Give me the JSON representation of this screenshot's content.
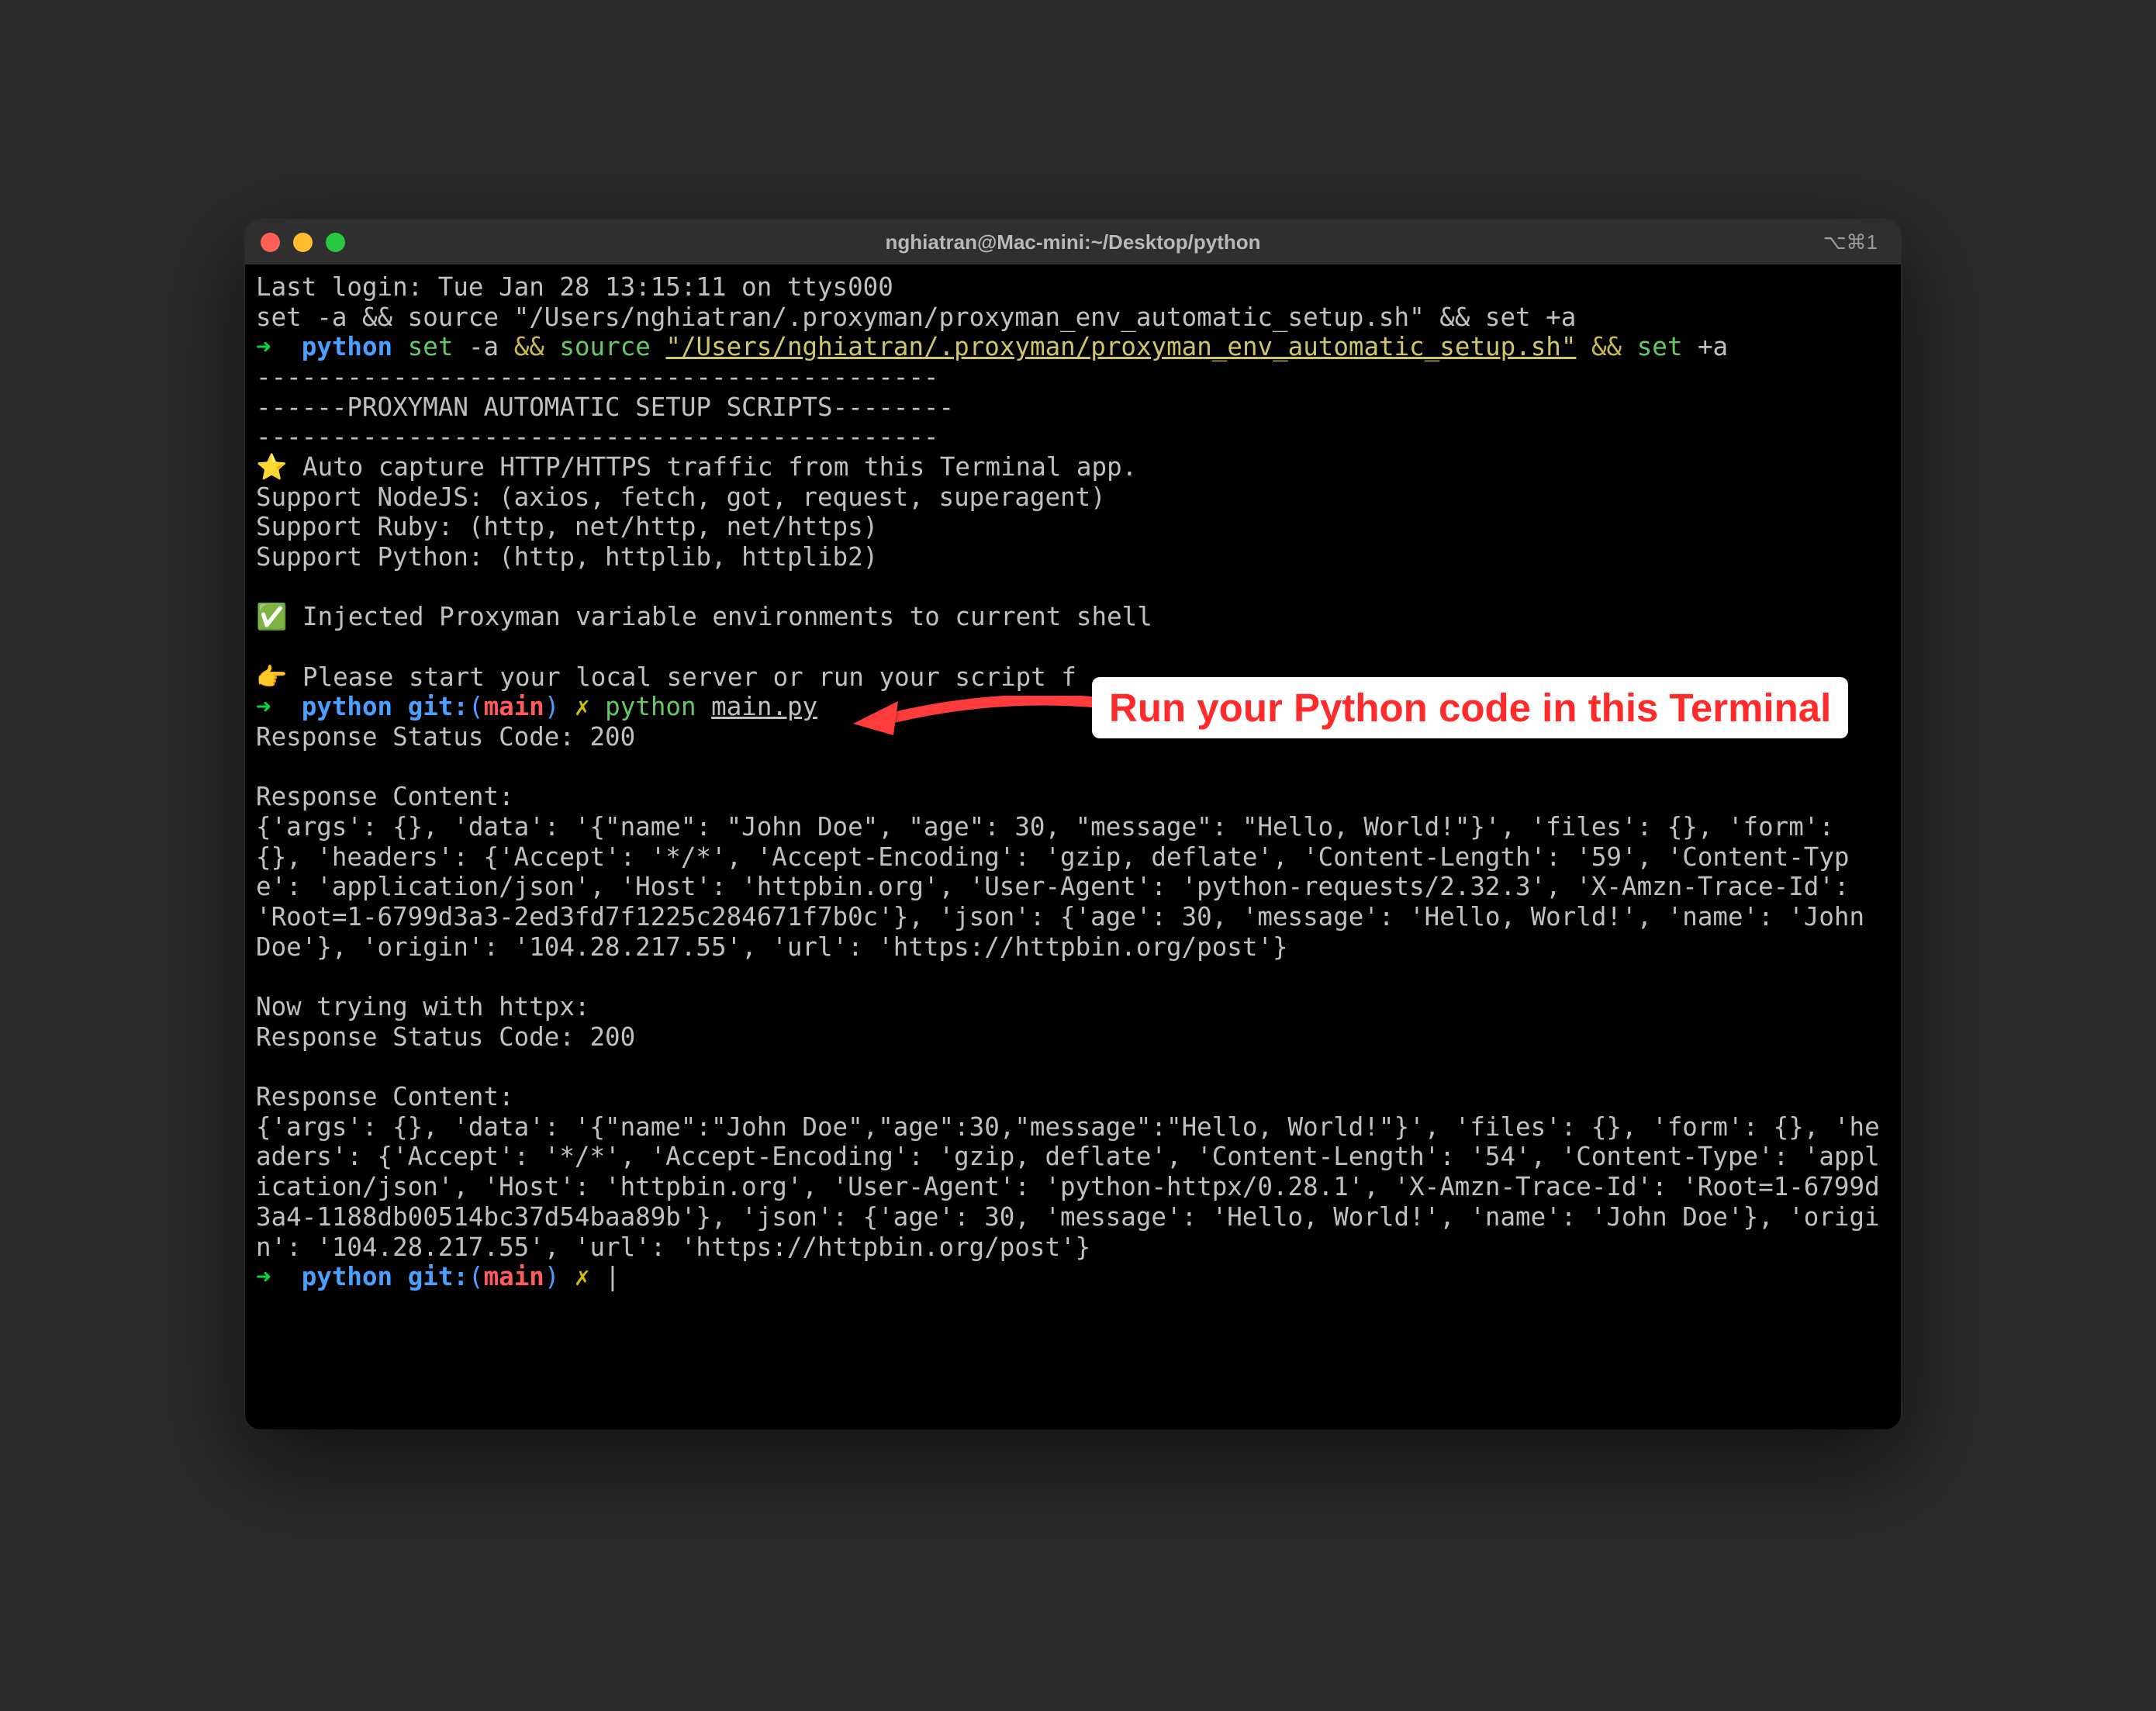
{
  "window": {
    "title": "nghiatran@Mac-mini:~/Desktop/python",
    "shortcut": "⌥⌘1"
  },
  "prompt": {
    "arrow": "➜",
    "env": "python",
    "git_label": "git:",
    "branch": "main",
    "dirty_marker": "✗"
  },
  "lines": {
    "last_login": "Last login: Tue Jan 28 13:15:11 on ttys000",
    "source_cmd": "set -a && source \"/Users/nghiatran/.proxyman/proxyman_env_automatic_setup.sh\" && set +a",
    "p1_set_a": "set",
    "p1_dash_a": "-a",
    "p1_and": "&&",
    "p1_source": "source",
    "p1_path": "\"/Users/nghiatran/.proxyman/proxyman_env_automatic_setup.sh\"",
    "p1_set_plus": "set",
    "p1_plus_a": "+a",
    "div1": "---------------------------------------------",
    "banner": "------PROXYMAN AUTOMATIC SETUP SCRIPTS--------",
    "div2": "---------------------------------------------",
    "auto_capture": "⭐️ Auto capture HTTP/HTTPS traffic from this Terminal app.",
    "support_node": "Support NodeJS: (axios, fetch, got, request, superagent)",
    "support_ruby": "Support Ruby: (http, net/http, net/https)",
    "support_python": "Support Python: (http, httplib, httplib2)",
    "injected": "✅ Injected Proxyman variable environments to current shell",
    "please_start": "👉 Please start your local server or run your script f",
    "p2_python": "python",
    "p2_file": "main.py",
    "resp_status_1": "Response Status Code: 200",
    "resp_content_label_1": "Response Content:",
    "resp_body_1": "{'args': {}, 'data': '{\"name\": \"John Doe\", \"age\": 30, \"message\": \"Hello, World!\"}', 'files': {}, 'form': {}, 'headers': {'Accept': '*/*', 'Accept-Encoding': 'gzip, deflate', 'Content-Length': '59', 'Content-Type': 'application/json', 'Host': 'httpbin.org', 'User-Agent': 'python-requests/2.32.3', 'X-Amzn-Trace-Id': 'Root=1-6799d3a3-2ed3fd7f1225c284671f7b0c'}, 'json': {'age': 30, 'message': 'Hello, World!', 'name': 'John Doe'}, 'origin': '104.28.217.55', 'url': 'https://httpbin.org/post'}",
    "now_httpx": "Now trying with httpx:",
    "resp_status_2": "Response Status Code: 200",
    "resp_content_label_2": "Response Content:",
    "resp_body_2": "{'args': {}, 'data': '{\"name\":\"John Doe\",\"age\":30,\"message\":\"Hello, World!\"}', 'files': {}, 'form': {}, 'headers': {'Accept': '*/*', 'Accept-Encoding': 'gzip, deflate', 'Content-Length': '54', 'Content-Type': 'application/json', 'Host': 'httpbin.org', 'User-Agent': 'python-httpx/0.28.1', 'X-Amzn-Trace-Id': 'Root=1-6799d3a4-1188db00514bc37d54baa89b'}, 'json': {'age': 30, 'message': 'Hello, World!', 'name': 'John Doe'}, 'origin': '104.28.217.55', 'url': 'https://httpbin.org/post'}"
  },
  "annotation": {
    "text": "Run your Python code in this Terminal"
  }
}
